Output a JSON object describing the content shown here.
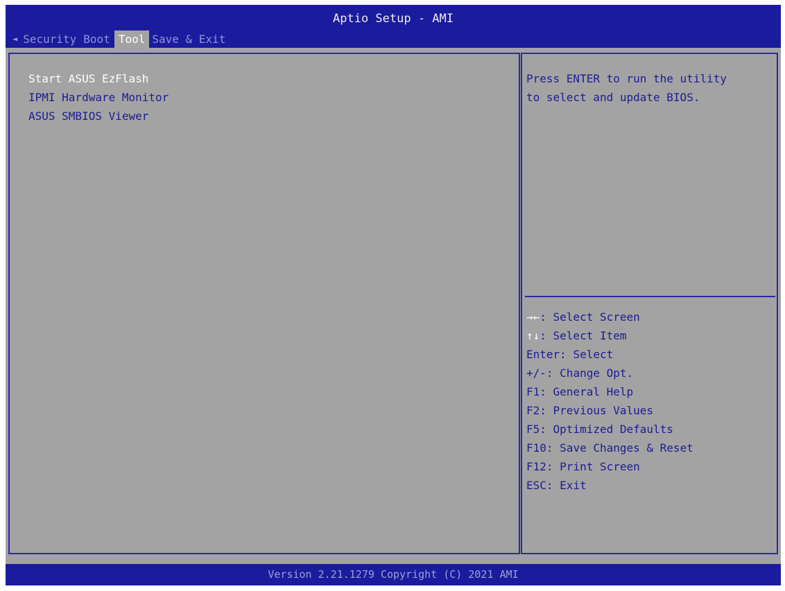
{
  "header": {
    "title": "Aptio Setup - AMI",
    "nav_arrow": "◄",
    "tabs": [
      {
        "label": "Security",
        "active": false
      },
      {
        "label": "Boot",
        "active": false
      },
      {
        "label": "Tool",
        "active": true
      },
      {
        "label": "Save & Exit",
        "active": false
      }
    ]
  },
  "main": {
    "menu_items": [
      {
        "label": "Start ASUS EzFlash",
        "selected": true
      },
      {
        "label": "IPMI Hardware Monitor",
        "selected": false
      },
      {
        "label": "ASUS SMBIOS Viewer",
        "selected": false
      }
    ]
  },
  "help": {
    "lines": [
      "Press ENTER to run the utility",
      "to select and update BIOS."
    ],
    "keys": [
      {
        "key": "→←",
        "desc": ": Select Screen"
      },
      {
        "key": "↑↓",
        "desc": ": Select Item"
      },
      {
        "key": "Enter",
        "desc": ": Select"
      },
      {
        "key": "+/-",
        "desc": ": Change Opt."
      },
      {
        "key": "F1",
        "desc": ": General Help"
      },
      {
        "key": "F2",
        "desc": ": Previous Values"
      },
      {
        "key": "F5",
        "desc": ": Optimized Defaults"
      },
      {
        "key": "F10",
        "desc": ": Save Changes & Reset"
      },
      {
        "key": "F12",
        "desc": ": Print Screen"
      },
      {
        "key": "ESC",
        "desc": ": Exit"
      }
    ]
  },
  "footer": {
    "version": "Version 2.21.1279 Copyright (C) 2021 AMI"
  },
  "colors": {
    "header_bg": "#1b1b9e",
    "panel_bg": "#a3a3a3",
    "text_blue": "#1c1c95",
    "highlight_white": "#ffffff"
  }
}
